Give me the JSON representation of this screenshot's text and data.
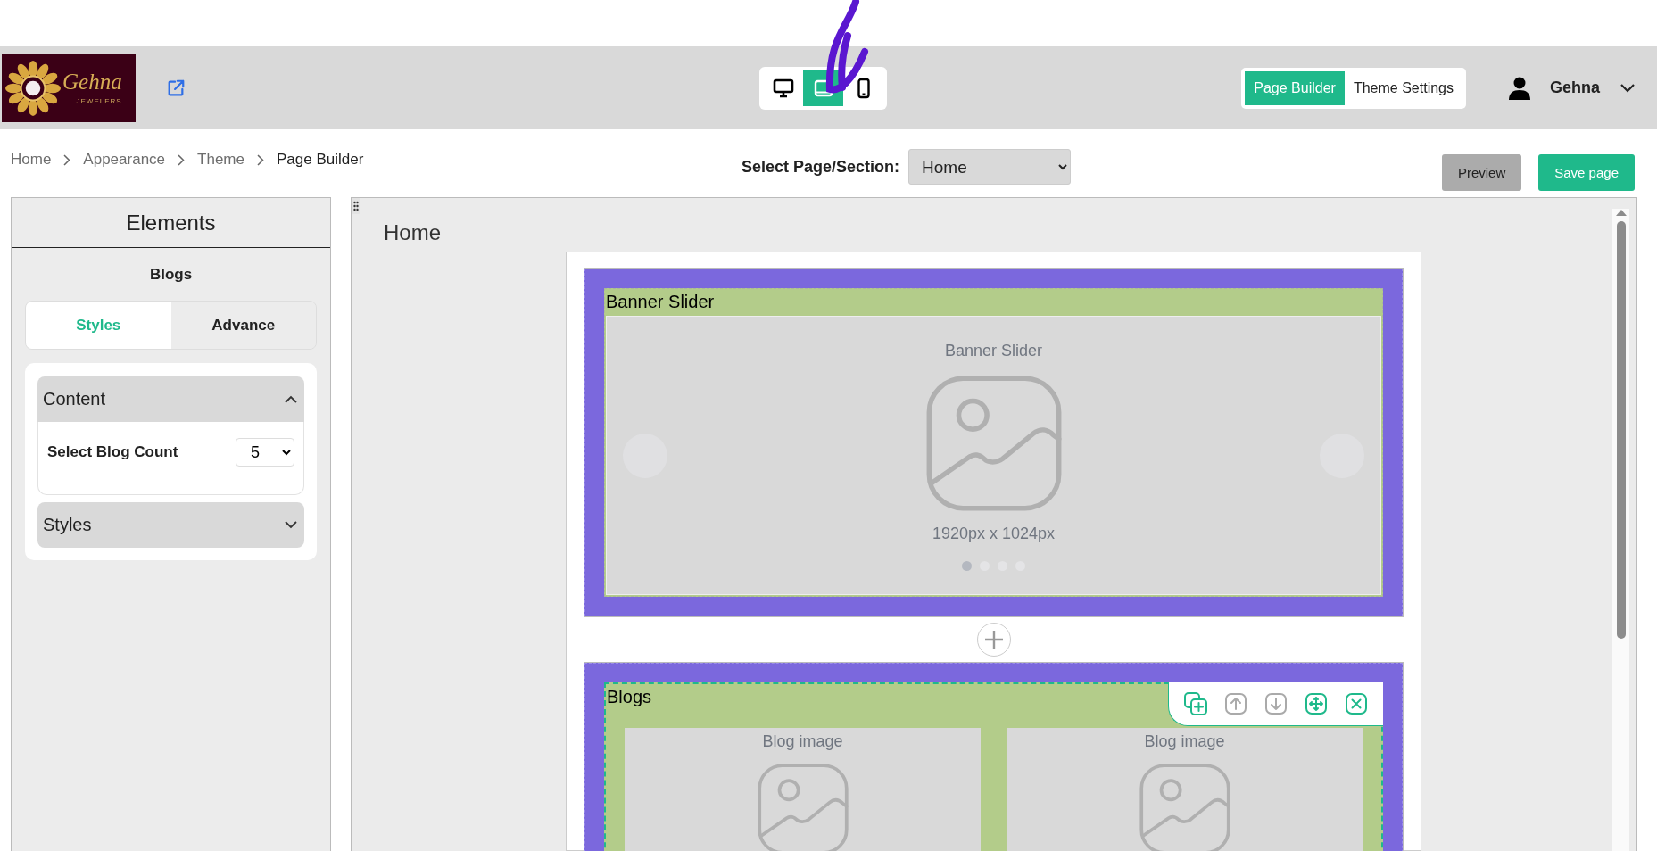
{
  "logo": {
    "name": "Gehna",
    "tagline": "JEWELERS"
  },
  "device_switcher": [
    {
      "kind": "desktop",
      "selected": false
    },
    {
      "kind": "tablet",
      "selected": true
    },
    {
      "kind": "mobile",
      "selected": false
    }
  ],
  "mode_toggle": [
    {
      "label": "Page Builder",
      "selected": true
    },
    {
      "label": "Theme Settings",
      "selected": false
    }
  ],
  "user": {
    "name": "Gehna"
  },
  "breadcrumb": [
    "Home",
    "Appearance",
    "Theme",
    "Page Builder"
  ],
  "page_select": {
    "label": "Select Page/Section:",
    "value": "Home"
  },
  "actions": [
    {
      "label": "Preview",
      "kind": "secondary"
    },
    {
      "label": "Save page",
      "kind": "primary"
    }
  ],
  "elements_panel": {
    "title": "Elements",
    "element": "Blogs",
    "tabs": [
      {
        "label": "Styles",
        "selected": true
      },
      {
        "label": "Advance",
        "selected": false
      }
    ],
    "accordions": [
      {
        "title": "Content",
        "expanded": true,
        "fields": [
          {
            "label": "Select Blog Count",
            "value": "5"
          }
        ]
      },
      {
        "title": "Styles",
        "expanded": false
      }
    ]
  },
  "canvas": {
    "page_title": "Home",
    "sections": [
      {
        "kind": "banner",
        "title": "Banner Slider",
        "selected": false,
        "placeholder_title": "Banner Slider",
        "size": "1920px x 1024px",
        "slides": [
          {
            "selected": true
          },
          {
            "selected": false
          },
          {
            "selected": false
          },
          {
            "selected": false
          }
        ]
      },
      {
        "kind": "blogs",
        "title": "Blogs",
        "selected": true,
        "cards": [
          {
            "label": "Blog image"
          },
          {
            "label": "Blog image"
          }
        ],
        "tools": [
          {
            "kind": "duplicate",
            "disabled": false
          },
          {
            "kind": "up",
            "disabled": true
          },
          {
            "kind": "down",
            "disabled": true
          },
          {
            "kind": "move",
            "disabled": false
          },
          {
            "kind": "delete",
            "disabled": false
          }
        ]
      }
    ]
  }
}
